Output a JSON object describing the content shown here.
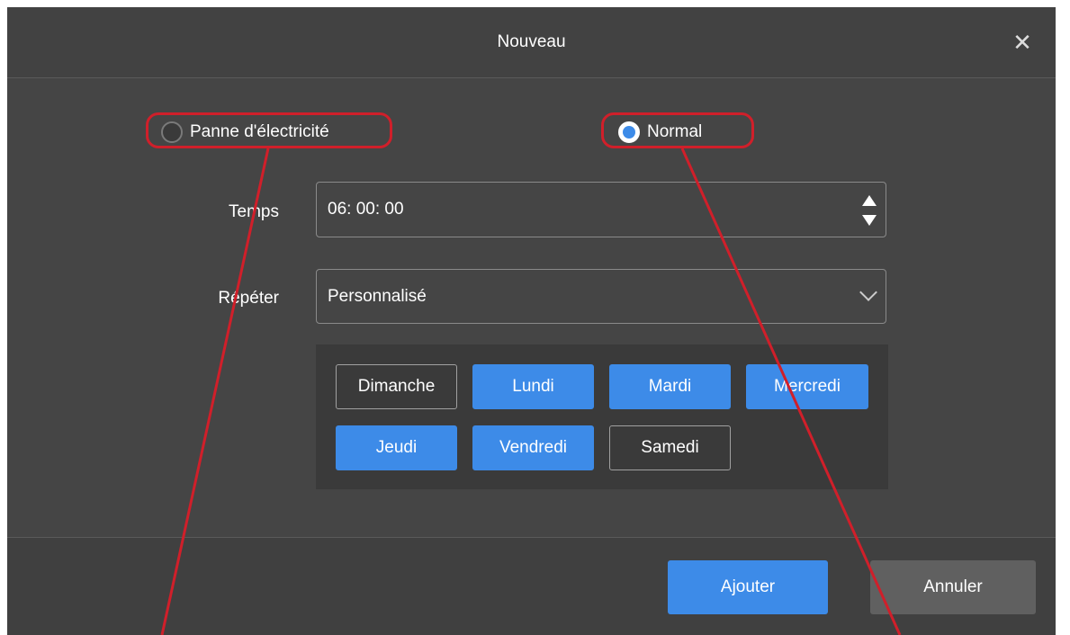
{
  "dialog": {
    "title": "Nouveau",
    "close_glyph": "✕"
  },
  "mode": {
    "options": [
      {
        "label": "Panne d'électricité",
        "selected": false
      },
      {
        "label": "Normal",
        "selected": true
      }
    ]
  },
  "time": {
    "label": "Temps",
    "value": "06: 00: 00"
  },
  "repeat": {
    "label": "Répéter",
    "value": "Personnalisé"
  },
  "days": [
    {
      "label": "Dimanche",
      "active": false
    },
    {
      "label": "Lundi",
      "active": true
    },
    {
      "label": "Mardi",
      "active": true
    },
    {
      "label": "Mercredi",
      "active": true
    },
    {
      "label": "Jeudi",
      "active": true
    },
    {
      "label": "Vendredi",
      "active": true
    },
    {
      "label": "Samedi",
      "active": false
    }
  ],
  "footer": {
    "add_label": "Ajouter",
    "cancel_label": "Annuler"
  },
  "colors": {
    "accent": "#3d8be8",
    "annotation": "#d01f2a",
    "background": "#454545"
  }
}
